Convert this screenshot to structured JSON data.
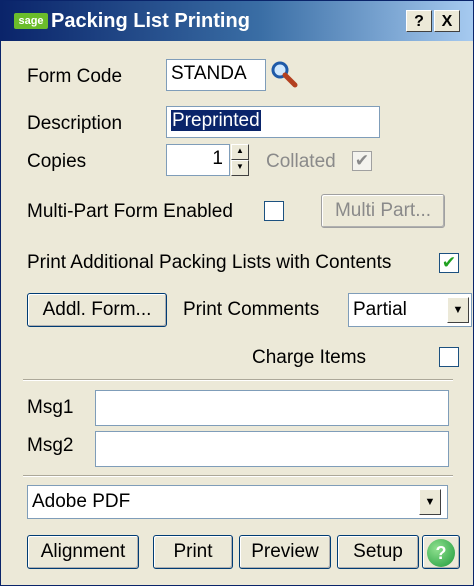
{
  "window": {
    "logo": "sage",
    "title": "Packing List Printing",
    "help_btn": "?",
    "close_btn": "X"
  },
  "form": {
    "form_code_label": "Form Code",
    "form_code_value": "STANDA",
    "description_label": "Description",
    "description_value": "Preprinted",
    "copies_label": "Copies",
    "copies_value": "1",
    "collated_label": "Collated",
    "collated_checked": true,
    "multipart_label": "Multi-Part Form Enabled",
    "multipart_checked": false,
    "multipart_button": "Multi Part...",
    "addl_packing_label": "Print Additional Packing Lists with Contents",
    "addl_packing_checked": true,
    "addl_form_button": "Addl. Form...",
    "print_comments_label": "Print Comments",
    "print_comments_value": "Partial",
    "charge_items_label": "Charge Items",
    "charge_items_checked": false,
    "msg1_label": "Msg1",
    "msg1_value": "",
    "msg2_label": "Msg2",
    "msg2_value": ""
  },
  "printer": {
    "value": "Adobe PDF"
  },
  "buttons": {
    "alignment": "Alignment",
    "print": "Print",
    "preview": "Preview",
    "setup": "Setup",
    "help": "?"
  },
  "colors": {
    "title_start": "#0a246a",
    "title_end": "#a6caf0",
    "window_bg": "#ece9d8",
    "check_green": "#21a121"
  }
}
